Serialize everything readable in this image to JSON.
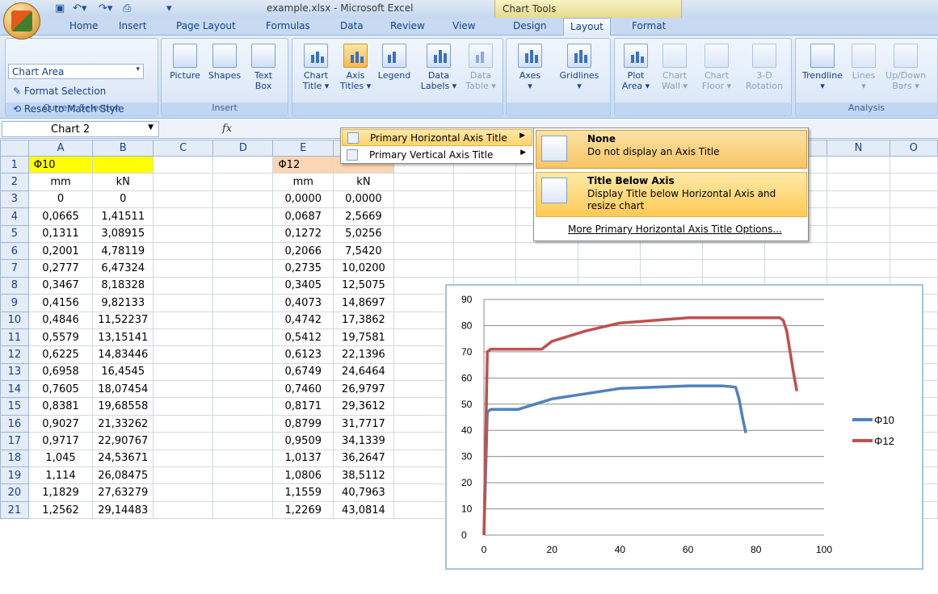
{
  "window": {
    "title": "example.xlsx - Microsoft Excel",
    "context_tab": "Chart Tools"
  },
  "tabs": [
    {
      "label": "Home"
    },
    {
      "label": "Insert"
    },
    {
      "label": "Page Layout"
    },
    {
      "label": "Formulas"
    },
    {
      "label": "Data"
    },
    {
      "label": "Review"
    },
    {
      "label": "View"
    },
    {
      "label": "Design"
    },
    {
      "label": "Layout",
      "active": true
    },
    {
      "label": "Format"
    }
  ],
  "ribbon": {
    "current_selection": {
      "dropdown": "Chart Area",
      "format_selection": "Format Selection",
      "reset_style": "Reset to Match Style",
      "label": "Current Selection"
    },
    "insert": {
      "picture": "Picture",
      "shapes": "Shapes",
      "text_box_1": "Text",
      "text_box_2": "Box",
      "label": "Insert"
    },
    "labels_group": {
      "chart_title_1": "Chart",
      "chart_title_2": "Title ▾",
      "axis_titles_1": "Axis",
      "axis_titles_2": "Titles ▾",
      "legend": "Legend",
      "data_labels_1": "Data",
      "data_labels_2": "Labels ▾",
      "data_table_1": "Data",
      "data_table_2": "Table ▾"
    },
    "axes_group": {
      "axes": "Axes",
      "gridlines": "Gridlines"
    },
    "background": {
      "plot_area_1": "Plot",
      "plot_area_2": "Area ▾",
      "chart_wall_1": "Chart",
      "chart_wall_2": "Wall ▾",
      "chart_floor_1": "Chart",
      "chart_floor_2": "Floor ▾",
      "rotation_1": "3-D",
      "rotation_2": "Rotation"
    },
    "analysis": {
      "trendline": "Trendline",
      "lines": "Lines",
      "updown_1": "Up/Down",
      "updown_2": "Bars ▾",
      "label": "Analysis"
    }
  },
  "formula_bar": {
    "name_box": "Chart 2",
    "fx": "fx"
  },
  "menu": {
    "items": [
      {
        "label": "Primary Horizontal Axis Title",
        "highlighted": true
      },
      {
        "label": "Primary Vertical Axis Title"
      }
    ]
  },
  "submenu": {
    "none_title": "None",
    "none_desc": "Do not display an Axis Title",
    "below_title": "Title Below Axis",
    "below_desc_1": "Display Title below Horizontal Axis and",
    "below_desc_2": "resize chart",
    "more": "More Primary Horizontal Axis Title Options..."
  },
  "sheet": {
    "columns": [
      "A",
      "B",
      "C",
      "D",
      "E",
      "F",
      "G",
      "H",
      "I",
      "J",
      "K",
      "L",
      "M",
      "N",
      "O"
    ],
    "rows": [
      [
        "Φ10",
        "",
        "",
        "",
        "Φ12",
        ""
      ],
      [
        "mm",
        "kN",
        "",
        "",
        "mm",
        "kN"
      ],
      [
        "0",
        "0",
        "",
        "",
        "0,0000",
        "0,0000"
      ],
      [
        "0,0665",
        "1,41511",
        "",
        "",
        "0,0687",
        "2,5669"
      ],
      [
        "0,1311",
        "3,08915",
        "",
        "",
        "0,1272",
        "5,0256"
      ],
      [
        "0,2001",
        "4,78119",
        "",
        "",
        "0,2066",
        "7,5420"
      ],
      [
        "0,2777",
        "6,47324",
        "",
        "",
        "0,2735",
        "10,0200"
      ],
      [
        "0,3467",
        "8,18328",
        "",
        "",
        "0,3405",
        "12,5075"
      ],
      [
        "0,4156",
        "9,82133",
        "",
        "",
        "0,4073",
        "14,8697"
      ],
      [
        "0,4846",
        "11,52237",
        "",
        "",
        "0,4742",
        "17,3862"
      ],
      [
        "0,5579",
        "13,15141",
        "",
        "",
        "0,5412",
        "19,7581"
      ],
      [
        "0,6225",
        "14,83446",
        "",
        "",
        "0,6123",
        "22,1396"
      ],
      [
        "0,6958",
        "16,4545",
        "",
        "",
        "0,6749",
        "24,6464"
      ],
      [
        "0,7605",
        "18,07454",
        "",
        "",
        "0,7460",
        "26,9797"
      ],
      [
        "0,8381",
        "19,68558",
        "",
        "",
        "0,8171",
        "29,3612"
      ],
      [
        "0,9027",
        "21,33262",
        "",
        "",
        "0,8799",
        "31,7717"
      ],
      [
        "0,9717",
        "22,90767",
        "",
        "",
        "0,9509",
        "34,1339"
      ],
      [
        "1,045",
        "24,53671",
        "",
        "",
        "1,0137",
        "36,2647"
      ],
      [
        "1,114",
        "26,08475",
        "",
        "",
        "1,0806",
        "38,5112"
      ],
      [
        "1,1829",
        "27,63279",
        "",
        "",
        "1,1559",
        "40,7963"
      ],
      [
        "1,2562",
        "29,14483",
        "",
        "",
        "1,2269",
        "43,0814"
      ]
    ],
    "highlight_a1": "#ffff00",
    "highlight_e1": "#fcd5b4"
  },
  "chart_data": {
    "type": "line",
    "xlim": [
      0,
      100
    ],
    "ylim": [
      0,
      90
    ],
    "xticks": [
      0,
      20,
      40,
      60,
      80,
      100
    ],
    "yticks": [
      0,
      10,
      20,
      30,
      40,
      50,
      60,
      70,
      80,
      90
    ],
    "grid": true,
    "legend": "right",
    "series": [
      {
        "name": "Φ10",
        "color": "#4f81bd",
        "x": [
          0,
          1,
          2,
          3,
          8,
          10,
          15,
          20,
          30,
          40,
          50,
          60,
          70,
          74,
          75,
          76,
          77
        ],
        "y": [
          0,
          47,
          48,
          48,
          48,
          48,
          50,
          52,
          54,
          56,
          56.5,
          57,
          57,
          56.5,
          52,
          45,
          39
        ]
      },
      {
        "name": "Φ12",
        "color": "#c0504d",
        "x": [
          0,
          1,
          2,
          3,
          10,
          17,
          20,
          30,
          40,
          50,
          60,
          70,
          80,
          87,
          88,
          89,
          90,
          91,
          92
        ],
        "y": [
          0,
          70,
          71,
          71,
          71,
          71,
          74,
          78,
          81,
          82,
          83,
          83,
          83,
          83,
          82,
          78,
          70,
          62,
          55
        ]
      }
    ]
  }
}
